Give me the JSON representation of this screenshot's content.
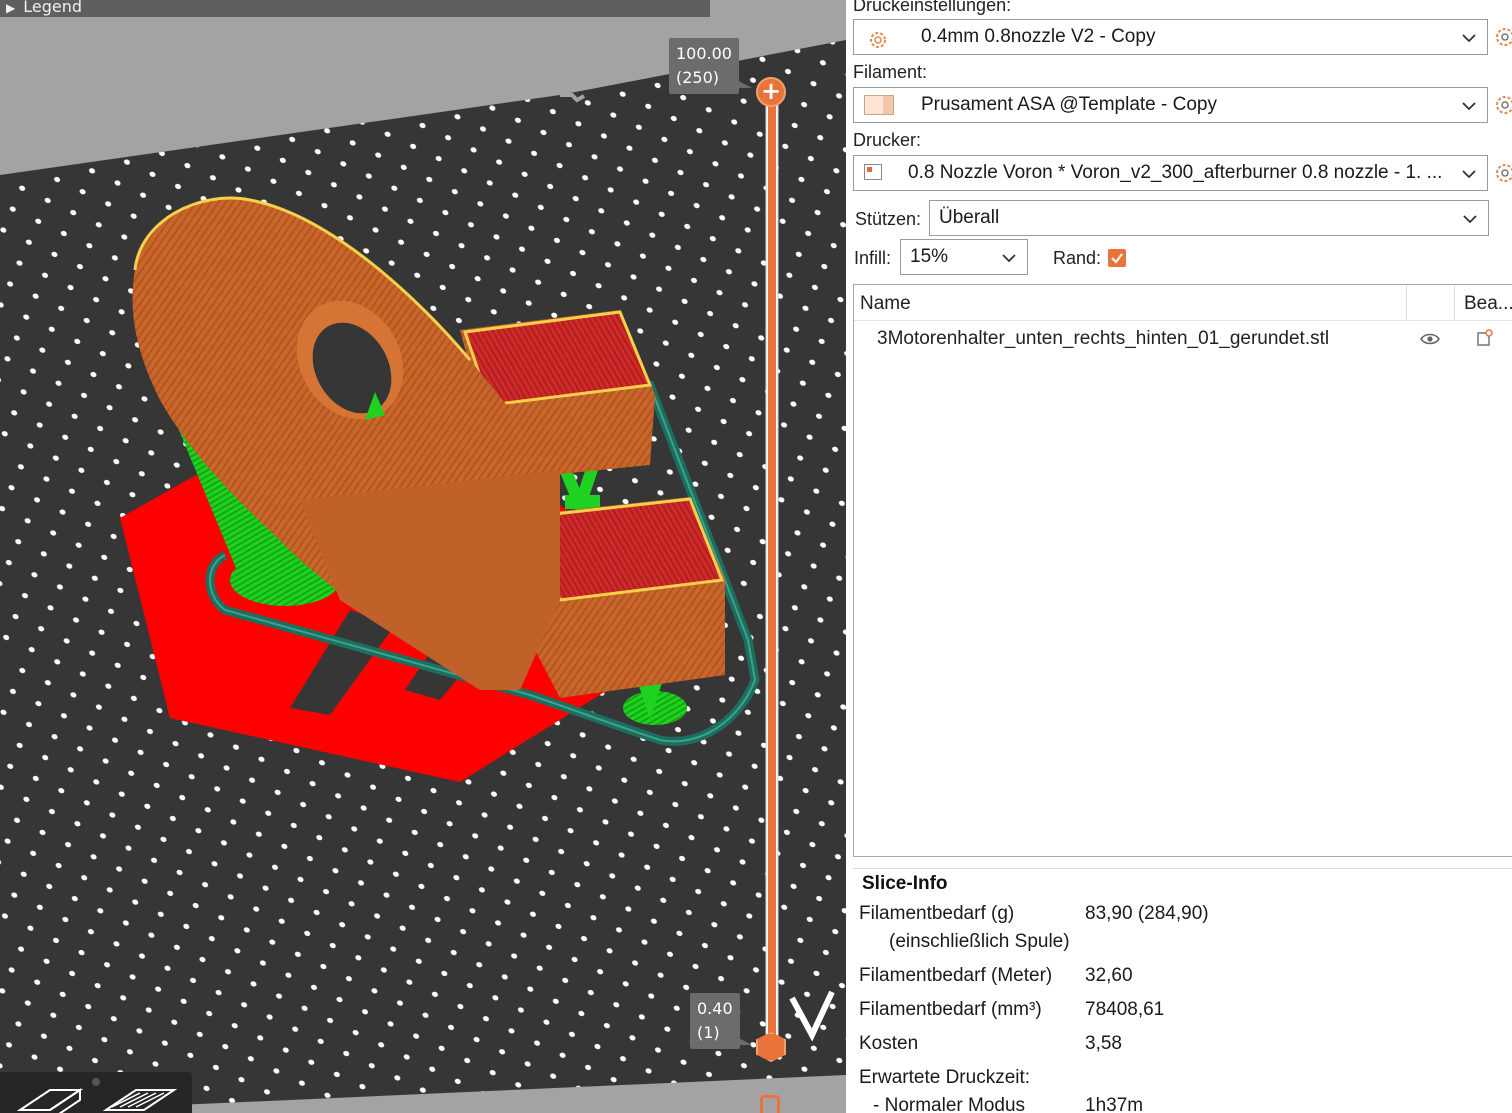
{
  "viewport": {
    "legend_label": "Legend",
    "layer_top": {
      "height": "100.00",
      "layer": "(250)"
    },
    "layer_bottom": {
      "height": "0.40",
      "layer": "(1)"
    }
  },
  "panel": {
    "print_settings": {
      "label": "Druckeinstellungen:",
      "value": "0.4mm 0.8nozzle V2 - Copy"
    },
    "filament": {
      "label": "Filament:",
      "value": "Prusament ASA @Template - Copy"
    },
    "printer": {
      "label": "Drucker:",
      "value": "0.8 Nozzle Voron  * Voron_v2_300_afterburner 0.8 nozzle - 1. ..."
    },
    "supports": {
      "label": "Stützen:",
      "value": "Überall"
    },
    "infill": {
      "label": "Infill:",
      "value": "15%"
    },
    "brim": {
      "label": "Rand:",
      "checked": true
    },
    "object_list": {
      "col_name": "Name",
      "col_edit": "Bea...",
      "objects": [
        {
          "name": "3Motorenhalter_unten_rechts_hinten_01_gerundet.stl"
        }
      ]
    },
    "slice_info": {
      "title": "Slice-Info",
      "filament_g_label": "Filamentbedarf (g)",
      "filament_g_sub": "(einschließlich Spule)",
      "filament_g_value": "83,90 (284,90)",
      "filament_m_label": "Filamentbedarf (Meter)",
      "filament_m_value": "32,60",
      "filament_mm3_label": "Filamentbedarf (mm³)",
      "filament_mm3_value": "78408,61",
      "cost_label": "Kosten",
      "cost_value": "3,58",
      "time_label": "Erwartete Druckzeit:",
      "normal_mode_label": "- Normaler Modus",
      "normal_mode_value": "1h37m"
    }
  },
  "colors": {
    "accent": "#e8743b",
    "model_orange": "#c8662b",
    "support_green": "#1fd21f",
    "infill_red": "#ff0000",
    "skirt_teal": "#1d6e5e",
    "bed": "#383838"
  }
}
